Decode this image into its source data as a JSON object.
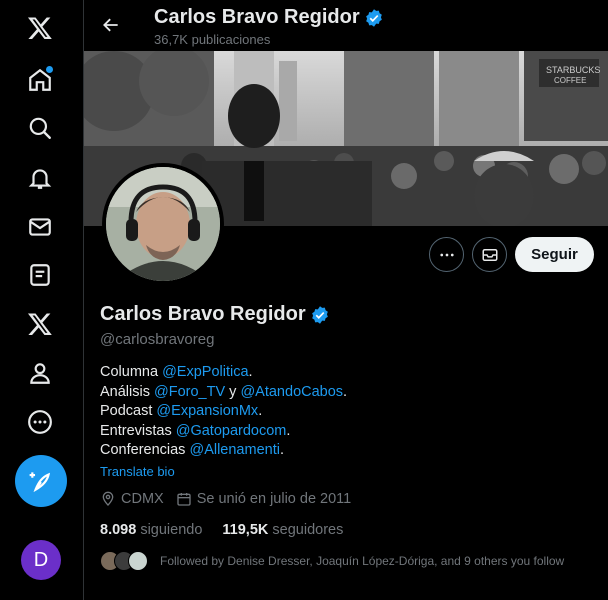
{
  "rail": {
    "items": [
      {
        "icon": "x-logo-icon"
      },
      {
        "icon": "home-icon"
      },
      {
        "icon": "search-icon"
      },
      {
        "icon": "notifications-bell-icon"
      },
      {
        "icon": "messages-envelope-icon"
      },
      {
        "icon": "lists-icon"
      },
      {
        "icon": "premium-x-icon"
      },
      {
        "icon": "profile-person-icon"
      },
      {
        "icon": "more-circle-icon"
      }
    ],
    "compose_icon": "compose-feather-icon",
    "account_initial": "D"
  },
  "header": {
    "name": "Carlos Bravo Regidor",
    "post_count": "36,7K publicaciones"
  },
  "profile": {
    "name": "Carlos Bravo Regidor",
    "handle": "@carlosbravoreg",
    "follow_label": "Seguir",
    "bio": {
      "l1_text": "Columna ",
      "l1_link": "@ExpPolitica",
      "l1_end": ".",
      "l2_text": "Análisis ",
      "l2_link1": "@Foro_TV",
      "l2_mid": " y ",
      "l2_link2": "@AtandoCabos",
      "l2_end": ".",
      "l3_text": "Podcast ",
      "l3_link": "@ExpansionMx",
      "l3_end": ".",
      "l4_text": "Entrevistas ",
      "l4_link": "@Gatopardocom",
      "l4_end": ".",
      "l5_text": "Conferencias ",
      "l5_link": "@Allenamenti",
      "l5_end": "."
    },
    "translate_label": "Translate bio",
    "location": "CDMX",
    "joined": "Se unió en julio de 2011",
    "following_count": "8.098",
    "following_label": "siguiendo",
    "followers_count": "119,5K",
    "followers_label": "seguidores",
    "followed_by": "Followed by Denise Dresser, Joaquín López-Dóriga, and 9 others you follow"
  },
  "colors": {
    "accent": "#1d9bf0",
    "background": "#000000",
    "muted": "#71767b"
  }
}
